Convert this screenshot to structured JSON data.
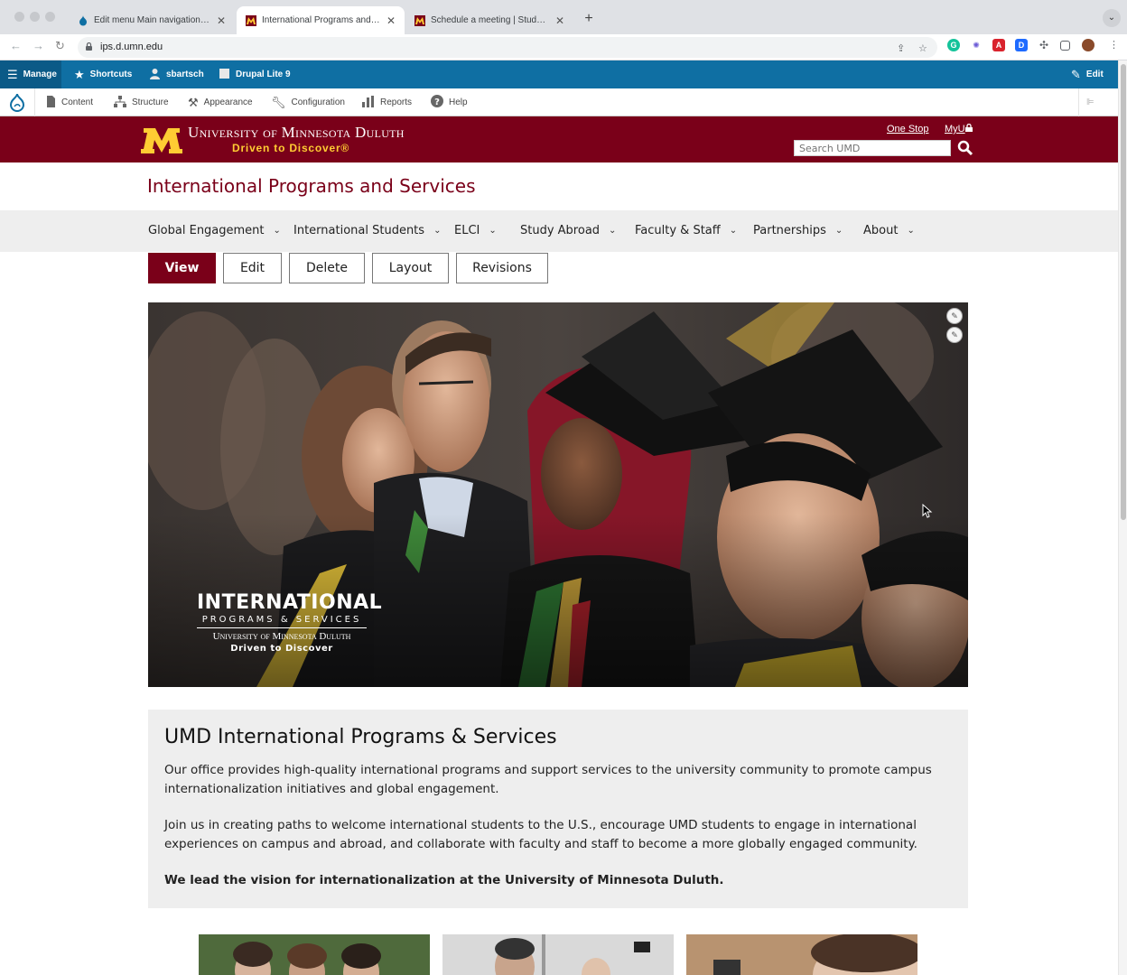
{
  "browser": {
    "tabs": [
      {
        "title": "Edit menu Main navigation | International",
        "active": false
      },
      {
        "title": "International Programs and Services",
        "active": true
      },
      {
        "title": "Schedule a meeting | Study Abroad",
        "active": false
      }
    ],
    "url": "ips.d.umn.edu"
  },
  "admin": {
    "manage": "Manage",
    "shortcuts": "Shortcuts",
    "user": "sbartsch",
    "site": "Drupal Lite 9",
    "edit": "Edit",
    "tray": [
      "Content",
      "Structure",
      "Appearance",
      "Configuration",
      "Reports",
      "Help"
    ]
  },
  "umd": {
    "name": "University of Minnesota Duluth",
    "tagline": "Driven to Discover®",
    "one_stop": "One Stop",
    "myu": "MyU",
    "search_placeholder": "Search UMD"
  },
  "site": {
    "title": "International Programs and Services",
    "nav": [
      "Global Engagement",
      "International Students",
      "ELCI",
      "Study Abroad",
      "Faculty & Staff",
      "Partnerships",
      "About"
    ]
  },
  "local_tabs": [
    "View",
    "Edit",
    "Delete",
    "Layout",
    "Revisions"
  ],
  "hero": {
    "brand_line1": "INTERNATIONAL",
    "brand_line2": "PROGRAMS & SERVICES",
    "brand_line3": "University of Minnesota Duluth",
    "brand_line4": "Driven to Discover"
  },
  "intro": {
    "heading": "UMD International Programs & Services",
    "p1": "Our office provides high-quality international programs and support services to the university community to promote campus internationalization initiatives and global engagement.",
    "p2": "Join us in creating paths to welcome international students to the U.S., encourage UMD students to engage in international experiences on campus and abroad, and collaborate with faculty and staff to become a more globally engaged community.",
    "p3": "We lead the vision for internationalization at the University of Minnesota Duluth."
  },
  "colors": {
    "maroon": "#7a0019",
    "gold": "#ffcc33",
    "drupal_blue": "#0f6fa3"
  }
}
